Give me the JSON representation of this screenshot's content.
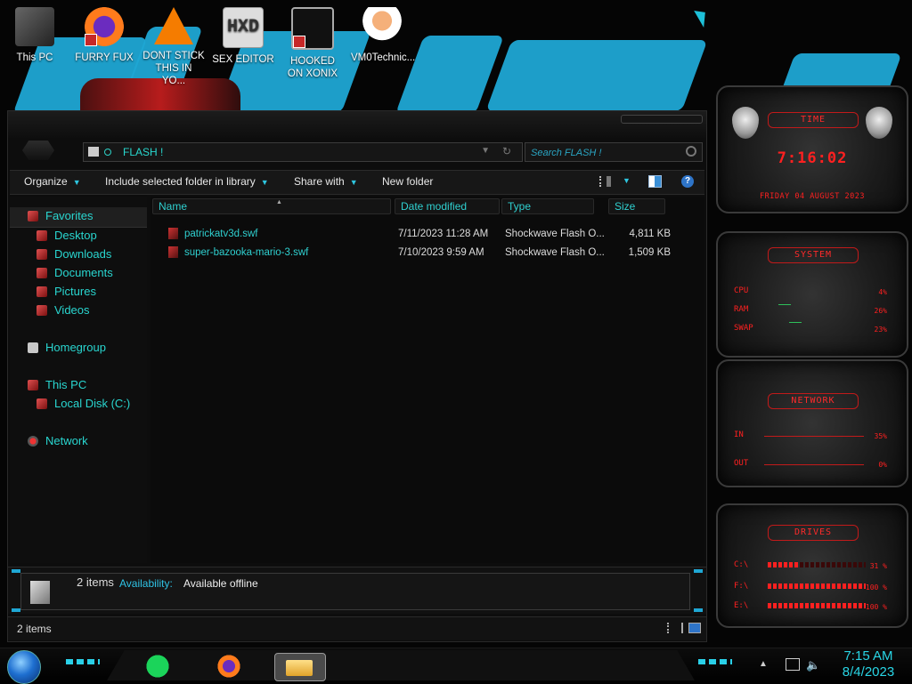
{
  "desktop": {
    "icons": [
      {
        "label": "This PC",
        "icon": "computer-icon"
      },
      {
        "label": "FURRY FUX",
        "icon": "firefox-icon"
      },
      {
        "label": "DONT STICK THIS IN YO...",
        "icon": "vlc-icon"
      },
      {
        "label": "SEX EDITOR",
        "icon": "hex-editor-icon"
      },
      {
        "label": "HOOKED ON XONIX",
        "icon": "xonix-icon"
      },
      {
        "label": "VM0Technic...",
        "icon": "doctor-icon"
      }
    ],
    "hxd_glyph": "HXD"
  },
  "explorer": {
    "address": "FLASH !",
    "search_placeholder": "Search FLASH !",
    "toolbar": {
      "organize": "Organize",
      "include": "Include selected folder in library",
      "share": "Share with",
      "new_folder": "New folder",
      "help_glyph": "?",
      "dropdown_caret": "▼"
    },
    "nav": {
      "favorites": "Favorites",
      "desktop": "Desktop",
      "downloads": "Downloads",
      "documents": "Documents",
      "pictures": "Pictures",
      "videos": "Videos",
      "homegroup": "Homegroup",
      "this_pc": "This PC",
      "local_disk": "Local Disk (C:)",
      "network": "Network"
    },
    "columns": {
      "name": "Name",
      "date": "Date modified",
      "type": "Type",
      "size": "Size"
    },
    "files": [
      {
        "name": "patrickatv3d.swf",
        "date": "7/11/2023 11:28 AM",
        "type": "Shockwave Flash O...",
        "size": "4,811 KB"
      },
      {
        "name": "super-bazooka-mario-3.swf",
        "date": "7/10/2023 9:59 AM",
        "type": "Shockwave Flash O...",
        "size": "1,509 KB"
      }
    ],
    "details": {
      "count": "2 items",
      "availability_label": "Availability:",
      "availability_value": "Available offline"
    },
    "status": "2 items"
  },
  "gadgets": {
    "time": {
      "title": "TIME",
      "clock": "7:16:02",
      "date": "FRIDAY 04 AUGUST 2023"
    },
    "system": {
      "title": "SYSTEM",
      "cpu_label": "CPU",
      "cpu": "4%",
      "ram_label": "RAM",
      "ram": "26%",
      "swap_label": "SWAP",
      "swap": "23%"
    },
    "network": {
      "title": "NETWORK",
      "in_label": "IN",
      "in": "35%",
      "out_label": "OUT",
      "out": "0%"
    },
    "drives": {
      "title": "DRIVES",
      "list": [
        {
          "label": "C:\\",
          "value": "31 %",
          "fraction": 0.31
        },
        {
          "label": "F:\\",
          "value": "100 %",
          "fraction": 1.0
        },
        {
          "label": "E:\\",
          "value": "100 %",
          "fraction": 1.0
        }
      ]
    }
  },
  "taskbar": {
    "time": "7:15 AM",
    "date": "8/4/2023",
    "apps": [
      "notes-app-icon",
      "firefox-icon",
      "file-explorer-icon"
    ],
    "volume_glyph": "🔈",
    "tray_glyph": "▲"
  },
  "colors": {
    "accent": "#28d8cf",
    "gadget_red": "#ff2020",
    "brush_blue": "#1fa7d4"
  }
}
